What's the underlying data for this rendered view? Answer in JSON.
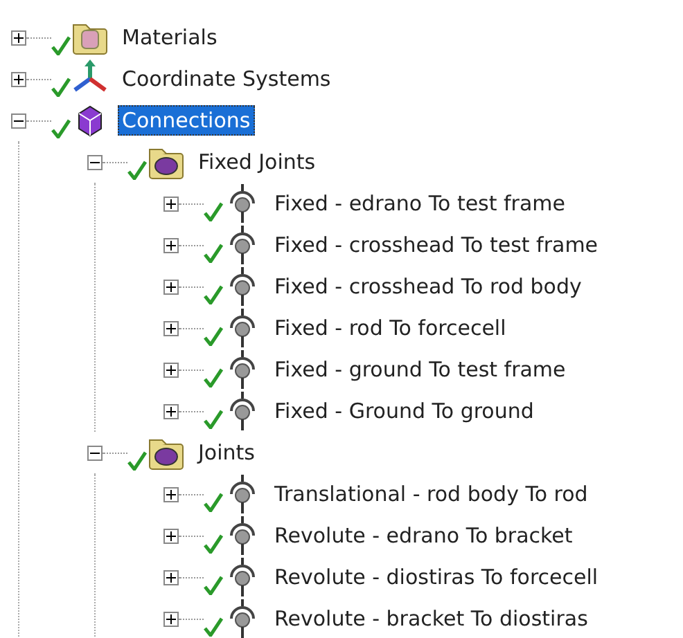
{
  "tree": [
    {
      "label": "Materials",
      "kind": "materials",
      "expanded": false,
      "selected": false
    },
    {
      "label": "Coordinate Systems",
      "kind": "axes",
      "expanded": false,
      "selected": false
    },
    {
      "label": "Connections",
      "kind": "connections",
      "expanded": true,
      "selected": true,
      "children": [
        {
          "label": "Fixed Joints",
          "kind": "folder",
          "expanded": true,
          "selected": false,
          "children": [
            {
              "label": "Fixed - edrano To test frame",
              "kind": "joint",
              "expanded": false,
              "selected": false
            },
            {
              "label": "Fixed - crosshead To test frame",
              "kind": "joint",
              "expanded": false,
              "selected": false
            },
            {
              "label": "Fixed - crosshead To rod body",
              "kind": "joint",
              "expanded": false,
              "selected": false
            },
            {
              "label": "Fixed - rod To forcecell",
              "kind": "joint",
              "expanded": false,
              "selected": false
            },
            {
              "label": "Fixed - ground To test frame",
              "kind": "joint",
              "expanded": false,
              "selected": false
            },
            {
              "label": "Fixed - Ground To ground",
              "kind": "joint",
              "expanded": false,
              "selected": false
            }
          ]
        },
        {
          "label": "Joints",
          "kind": "folder",
          "expanded": true,
          "selected": false,
          "children": [
            {
              "label": "Translational - rod body To rod",
              "kind": "joint",
              "expanded": false,
              "selected": false
            },
            {
              "label": "Revolute - edrano To bracket",
              "kind": "joint",
              "expanded": false,
              "selected": false
            },
            {
              "label": "Revolute - diostiras To forcecell",
              "kind": "joint",
              "expanded": false,
              "selected": false
            },
            {
              "label": "Revolute - bracket To diostiras",
              "kind": "joint",
              "expanded": false,
              "selected": false
            }
          ]
        }
      ]
    }
  ]
}
